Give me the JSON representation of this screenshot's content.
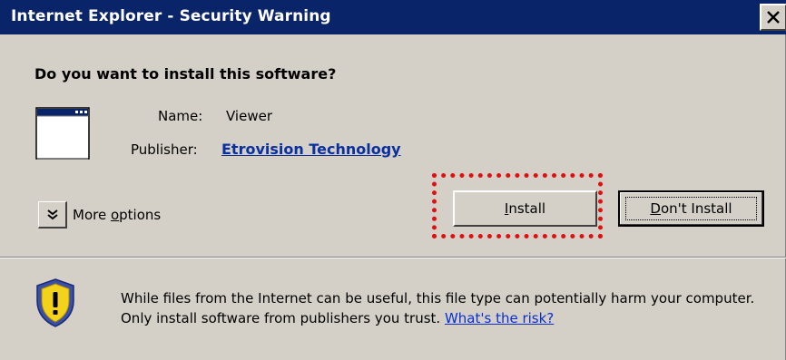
{
  "window": {
    "title": "Internet Explorer - Security Warning"
  },
  "prompt": {
    "question": "Do you want to install this software?"
  },
  "software": {
    "name_label": "Name:",
    "name_value": "Viewer",
    "publisher_label": "Publisher:",
    "publisher_value": "Etrovision Technology"
  },
  "more_options": {
    "label_pre": "More ",
    "label_accel": "o",
    "label_post": "ptions"
  },
  "buttons": {
    "install_accel": "I",
    "install_rest": "nstall",
    "dont_accel": "D",
    "dont_rest": "on't Install"
  },
  "warning": {
    "text": "While files from the Internet can be useful, this file type can potentially harm your computer. Only install software from publishers you trust. ",
    "link": "What's the risk?"
  },
  "colors": {
    "titlebar": "#0a246a",
    "dialog_bg": "#d4d0c8",
    "highlight": "#e01010",
    "link": "#0a2fd0"
  },
  "icons": [
    "close-icon",
    "application-window-icon",
    "chevron-down-icon",
    "warning-shield-icon"
  ]
}
